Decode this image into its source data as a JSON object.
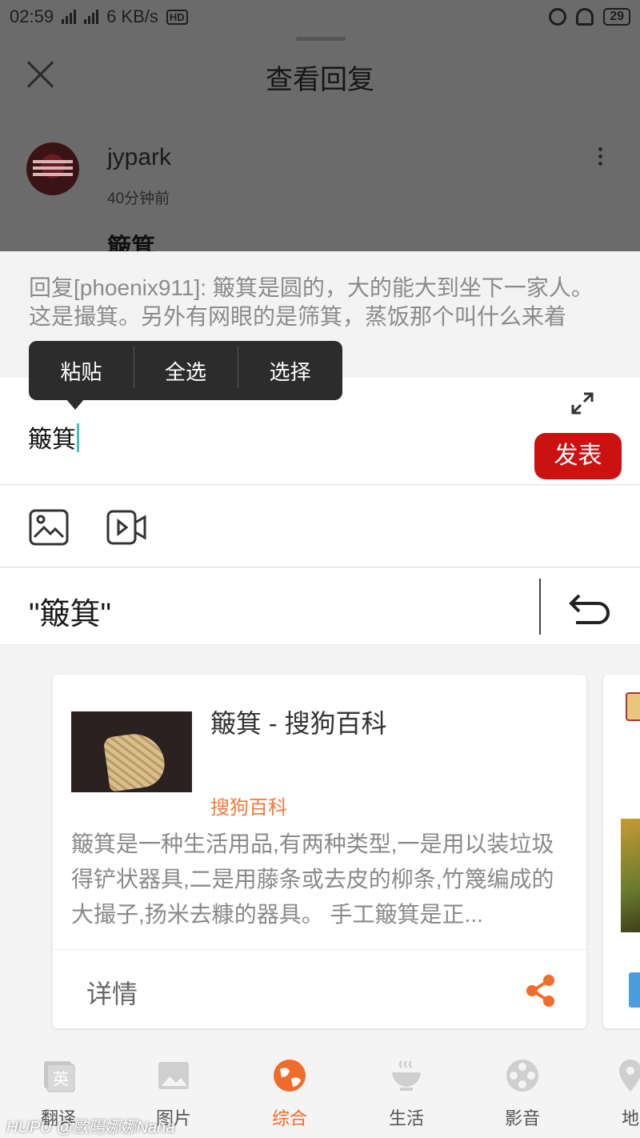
{
  "status_bar": {
    "time": "02:59",
    "signal1": "2G",
    "signal2": "4G",
    "speed": "6 KB/s",
    "hd": "HD",
    "battery": "29"
  },
  "sheet": {
    "title": "查看回复",
    "post": {
      "username": "jypark",
      "time": "40分钟前",
      "body": "簸箕"
    }
  },
  "reply": {
    "quote": "回复[phoenix911]: 簸箕是圆的，大的能大到坐下一家人。这是撮箕。另外有网眼的是筛箕，蒸饭那个叫什么来着",
    "input_text": "簸箕",
    "post_button": "发表"
  },
  "context_menu": {
    "items": [
      "粘贴",
      "全选",
      "选择"
    ]
  },
  "search": {
    "keyword": "\"簸箕\""
  },
  "result_card": {
    "title": "簸箕 - 搜狗百科",
    "source": "搜狗百科",
    "description": "簸箕是一种生活用品,有两种类型,一是用以装垃圾得铲状器具,二是用藤条或去皮的柳条,竹篾编成的大撮子,扬米去糠的器具。 手工簸箕是正...",
    "detail_label": "详情"
  },
  "bottom_nav": {
    "items": [
      {
        "label": "翻译",
        "icon": "translate-icon",
        "badge": "英"
      },
      {
        "label": "图片",
        "icon": "image-icon"
      },
      {
        "label": "综合",
        "icon": "globe-icon",
        "active": true
      },
      {
        "label": "生活",
        "icon": "bowl-icon"
      },
      {
        "label": "影音",
        "icon": "film-reel-icon"
      },
      {
        "label": "地",
        "icon": "map-pin-icon"
      }
    ]
  },
  "watermark": "HUPU @歐陽娜娜Nana",
  "colors": {
    "accent_red": "#cc1111",
    "accent_orange": "#ef6c2a",
    "caret": "#45c1b4"
  }
}
